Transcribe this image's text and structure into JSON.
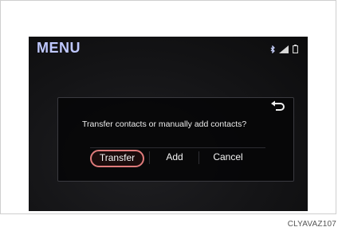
{
  "header": {
    "title": "MENU",
    "status_icons": [
      "bluetooth-icon",
      "signal-icon",
      "battery-icon"
    ]
  },
  "dialog": {
    "question": "Transfer contacts or manually add contacts?",
    "buttons": {
      "transfer": "Transfer",
      "add": "Add",
      "cancel": "Cancel"
    },
    "back_icon": "back-arrow-icon"
  },
  "figure": {
    "caption": "CLYAVAZ107"
  },
  "colors": {
    "screen_bg": "#141416",
    "menu_title": "#bfc8ff",
    "selected_outline": "#e07b7b",
    "text": "#ececec"
  }
}
